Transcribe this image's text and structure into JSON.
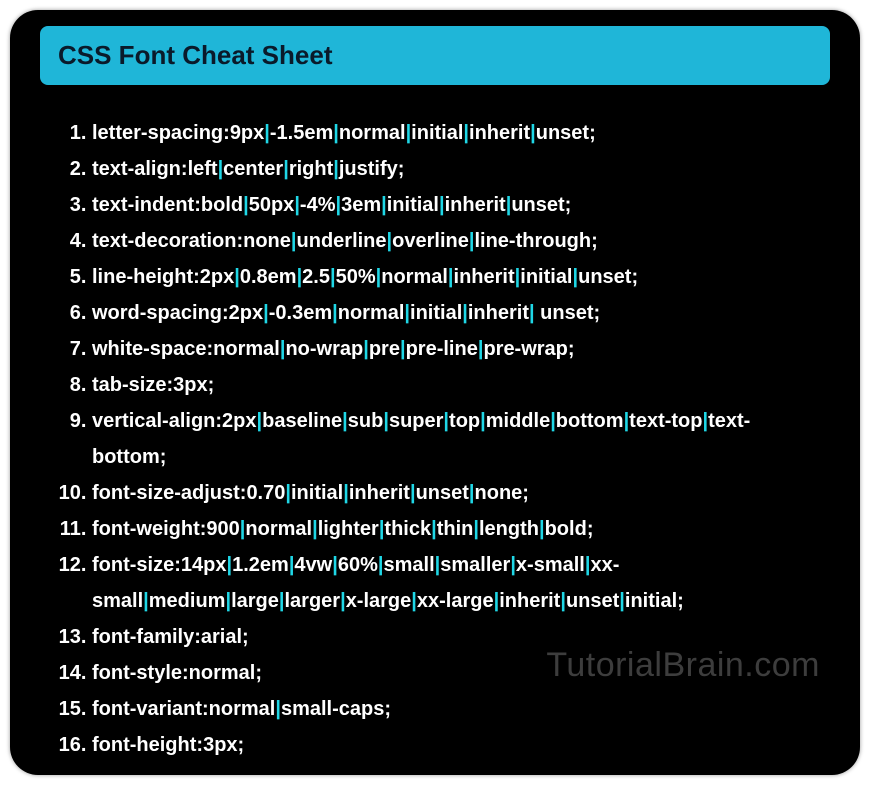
{
  "title": "CSS Font Cheat Sheet",
  "watermark": "TutorialBrain.com",
  "items": [
    {
      "property": "letter-spacing",
      "values": [
        "9px",
        "-1.5em",
        "normal",
        "initial",
        "inherit",
        "unset"
      ]
    },
    {
      "property": "text-align",
      "values": [
        "left",
        "center",
        "right",
        "justify"
      ]
    },
    {
      "property": "text-indent",
      "values": [
        "bold",
        "50px",
        "-4%",
        "3em",
        "initial",
        "inherit",
        "unset"
      ]
    },
    {
      "property": "text-decoration",
      "values": [
        "none",
        "underline",
        "overline",
        "line-through"
      ]
    },
    {
      "property": "line-height",
      "values": [
        "2px",
        "0.8em",
        "2.5",
        "50%",
        "normal",
        "inherit",
        "initial",
        "unset"
      ]
    },
    {
      "property": "word-spacing",
      "values": [
        "2px",
        "-0.3em",
        "normal",
        "initial",
        "inherit",
        " unset"
      ]
    },
    {
      "property": "white-space",
      "values": [
        "normal",
        "no-wrap",
        "pre",
        "pre-line",
        "pre-wrap"
      ]
    },
    {
      "property": "tab-size",
      "values": [
        "3px"
      ]
    },
    {
      "property": "vertical-align",
      "values": [
        "2px",
        "baseline",
        "sub",
        "super",
        "top",
        "middle",
        "bottom",
        "text-top",
        "text-bottom"
      ]
    },
    {
      "property": "font-size-adjust",
      "values": [
        "0.70",
        "initial",
        "inherit",
        "unset",
        "none"
      ]
    },
    {
      "property": "font-weight",
      "values": [
        "900",
        "normal",
        "lighter",
        "thick",
        "thin",
        "length",
        "bold"
      ]
    },
    {
      "property": "font-size",
      "values": [
        "14px",
        "1.2em",
        "4vw",
        "60%",
        "small",
        "smaller",
        "x-small",
        "xx-small",
        "medium",
        "large",
        "larger",
        "x-large",
        "xx-large",
        "inherit",
        "unset",
        "initial"
      ]
    },
    {
      "property": "font-family",
      "values": [
        "arial"
      ]
    },
    {
      "property": "font-style",
      "values": [
        "normal"
      ]
    },
    {
      "property": "font-variant",
      "values": [
        "normal",
        "small-caps"
      ]
    },
    {
      "property": "font-height",
      "values": [
        "3px"
      ]
    }
  ]
}
